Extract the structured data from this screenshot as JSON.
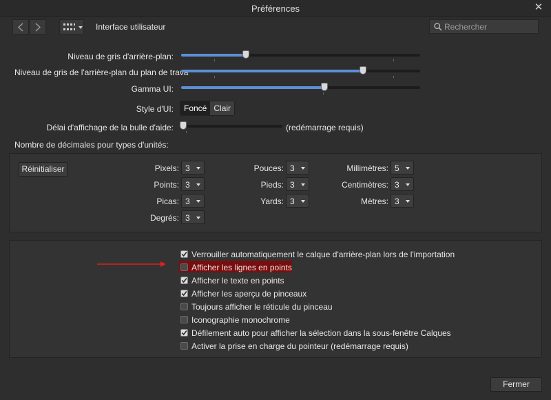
{
  "window": {
    "title": "Préférences"
  },
  "toolbar": {
    "section": "Interface utilisateur",
    "search_placeholder": "Rechercher"
  },
  "sliders": [
    {
      "label": "Niveau de gris d'arrière-plan:",
      "value": 0.27
    },
    {
      "label": "Niveau de gris de l'arrière-plan du plan de trava",
      "value": 0.76
    },
    {
      "label": "Gamma UI:",
      "value": 0.6
    }
  ],
  "ui_style": {
    "label": "Style d'UI:",
    "options": [
      "Foncé",
      "Clair"
    ],
    "selected": "Foncé"
  },
  "tooltip_delay": {
    "label": "Délai d'affichage de la bulle d'aide:",
    "value": 0.02,
    "note": "(redémarrage requis)"
  },
  "decimals": {
    "heading": "Nombre de décimales pour types d'unités:",
    "reset_label": "Réinitialiser",
    "units": [
      {
        "label": "Pixels:",
        "value": "3"
      },
      {
        "label": "Points:",
        "value": "3"
      },
      {
        "label": "Picas:",
        "value": "3"
      },
      {
        "label": "Degrés:",
        "value": "3"
      },
      {
        "label": "Pouces:",
        "value": "3"
      },
      {
        "label": "Pieds:",
        "value": "3"
      },
      {
        "label": "Yards:",
        "value": "3"
      },
      {
        "label": "Millimètres:",
        "value": "5"
      },
      {
        "label": "Centimètres:",
        "value": "3"
      },
      {
        "label": "Mètres:",
        "value": "3"
      }
    ]
  },
  "options": [
    {
      "label": "Verrouiller automatiquement le calque d'arrière-plan lors de l'importation",
      "checked": true
    },
    {
      "label": "Afficher les lignes en points",
      "checked": false,
      "highlighted": true
    },
    {
      "label": "Afficher le texte en points",
      "checked": true
    },
    {
      "label": "Afficher les aperçu de pinceaux",
      "checked": true
    },
    {
      "label": "Toujours afficher le réticule du pinceau",
      "checked": false
    },
    {
      "label": "Iconographie monochrome",
      "checked": false
    },
    {
      "label": "Défilement auto pour afficher la sélection dans la sous-fenêtre Calques",
      "checked": true
    },
    {
      "label": "Activer la prise en charge du pointeur (redémarrage requis)",
      "checked": false
    }
  ],
  "footer": {
    "close_label": "Fermer"
  },
  "colors": {
    "accent": "#5d8fd6",
    "highlight": "#7a0e0e",
    "annotation_arrow": "#e02020"
  }
}
